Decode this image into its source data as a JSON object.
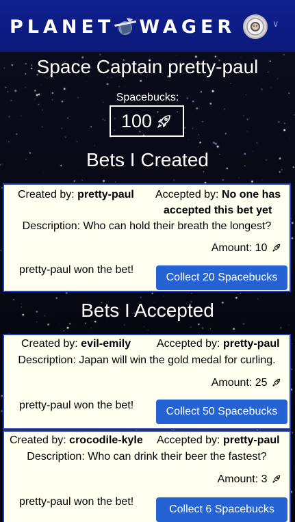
{
  "navbar": {
    "logo_left": "PLANET",
    "logo_right": "WAGER",
    "avatar_icon": "astronaut-avatar-icon",
    "dropdown_icon": "chevron-down-icon",
    "colors": {
      "background": "#0f1f8f"
    }
  },
  "profile": {
    "captain_title": "Space Captain pretty-paul",
    "spacebucks_label": "Spacebucks:",
    "spacebucks_value": "100",
    "currency_icon": "rocket-icon"
  },
  "sections": {
    "created_title": "Bets I Created",
    "accepted_title": "Bets I Accepted"
  },
  "labels": {
    "created_by": "Created by:",
    "accepted_by": "Accepted by:",
    "description": "Description:",
    "amount": "Amount:"
  },
  "bets_created": [
    {
      "creator": "pretty-paul",
      "acceptor": "No one has accepted this bet yet",
      "description": "Who can hold their breath the longest?",
      "amount": "10",
      "result": "pretty-paul won the bet!",
      "button": "Collect 20 Spacebucks"
    }
  ],
  "bets_accepted": [
    {
      "creator": "evil-emily",
      "acceptor": "pretty-paul",
      "description": "Japan will win the gold medal for curling.",
      "amount": "25",
      "result": "pretty-paul won the bet!",
      "button": "Collect 50 Spacebucks"
    },
    {
      "creator": "crocodile-kyle",
      "acceptor": "pretty-paul",
      "description": "Who can drink their beer the fastest?",
      "amount": "3",
      "result": "pretty-paul won the bet!",
      "button": "Collect 6 Spacebucks"
    }
  ],
  "colors": {
    "card_background": "#fffff0",
    "card_border": "#1f3fc6",
    "button": "#2563d4"
  }
}
